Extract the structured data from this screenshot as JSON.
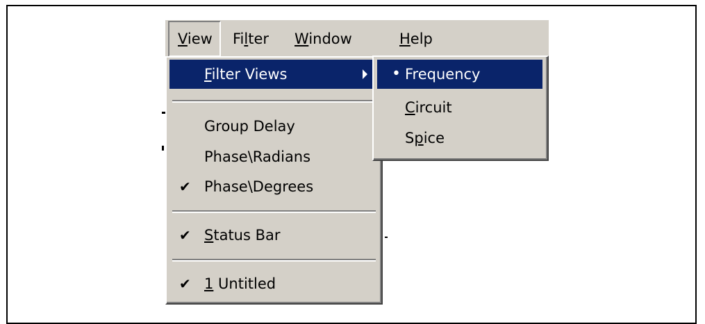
{
  "menubar": {
    "items": [
      {
        "pre": "",
        "acc": "V",
        "post": "iew"
      },
      {
        "pre": "Fi",
        "acc": "l",
        "post": "ter"
      },
      {
        "pre": "",
        "acc": "W",
        "post": "indow"
      },
      {
        "pre": "",
        "acc": "H",
        "post": "elp"
      }
    ]
  },
  "view_menu": {
    "filter_views": {
      "pre": "",
      "acc": "F",
      "post": "ilter Views"
    },
    "group_delay": "Group Delay",
    "phase_radians": "Phase\\Radians",
    "phase_degrees": "Phase\\Degrees",
    "status_bar": {
      "pre": "",
      "acc": "S",
      "post": "tatus Bar"
    },
    "recent_file": {
      "pre": "",
      "acc": "1",
      "post": " Untitled"
    },
    "check_mark": "✔"
  },
  "filter_views_submenu": {
    "frequency": "Frequency",
    "circuit": {
      "pre": "",
      "acc": "C",
      "post": "ircuit"
    },
    "spice": {
      "pre": "S",
      "acc": "p",
      "post": "ice"
    },
    "bullet": "•"
  },
  "colors": {
    "menu_bg": "#d4d0c8",
    "highlight": "#0a246a",
    "highlight_text": "#ffffff"
  }
}
